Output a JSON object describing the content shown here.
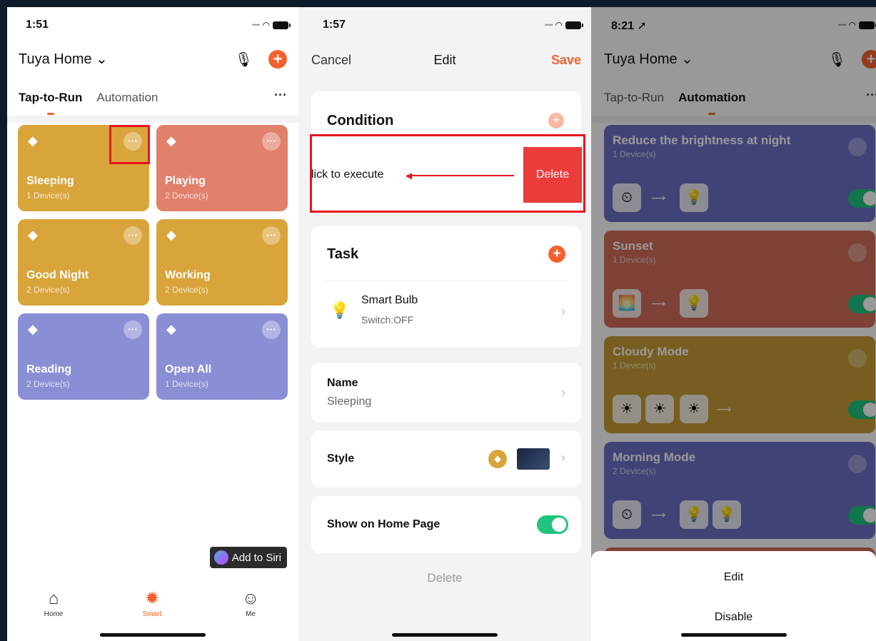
{
  "phone1": {
    "time": "1:51",
    "home_name": "Tuya Home ⌄",
    "tabs": [
      "Tap-to-Run",
      "Automation"
    ],
    "more": "···",
    "cards": [
      {
        "name": "Sleeping",
        "devices": "1 Device(s)",
        "color": "yellow"
      },
      {
        "name": "Playing",
        "devices": "2 Device(s)",
        "color": "salmon"
      },
      {
        "name": "Good Night",
        "devices": "2 Device(s)",
        "color": "yellow"
      },
      {
        "name": "Working",
        "devices": "2 Device(s)",
        "color": "yellow"
      },
      {
        "name": "Reading",
        "devices": "2 Device(s)",
        "color": "purple"
      },
      {
        "name": "Open All",
        "devices": "1 Device(s)",
        "color": "purple"
      }
    ],
    "siri": "Add to Siri",
    "tabbar": [
      {
        "label": "Home",
        "icon": "home-icon"
      },
      {
        "label": "Smart",
        "icon": "sun-icon",
        "active": true
      },
      {
        "label": "Me",
        "icon": "user-icon"
      }
    ]
  },
  "phone2": {
    "time": "1:57",
    "cancel": "Cancel",
    "title": "Edit",
    "save": "Save",
    "condition_title": "Condition",
    "condition_row": "lick to execute",
    "delete_swipe": "Delete",
    "task_title": "Task",
    "task_device": "Smart Bulb",
    "task_state": "Switch:OFF",
    "name_label": "Name",
    "name_value": "Sleeping",
    "style_label": "Style",
    "show_home_label": "Show on Home Page",
    "delete_bottom": "Delete"
  },
  "phone3": {
    "time": "8:21 ➚",
    "home_name": "Tuya Home ⌄",
    "tabs": [
      "Tap-to-Run",
      "Automation"
    ],
    "more": "···",
    "automations": [
      {
        "name": "Reduce the brightness at night",
        "devices": "1 Device(s)",
        "color": "#6d71c6"
      },
      {
        "name": "Sunset",
        "devices": "1 Device(s)",
        "color": "#d36d5b"
      },
      {
        "name": "Cloudy Mode",
        "devices": "1 Device(s)",
        "color": "#c79d36"
      },
      {
        "name": "Morning Mode",
        "devices": "2 Device(s)",
        "color": "#6d71c6"
      }
    ],
    "sheet_edit": "Edit",
    "sheet_disable": "Disable"
  },
  "colors": {
    "accent": "#f5612c",
    "highlight": "#e8151f",
    "toggle": "#21c47e"
  }
}
